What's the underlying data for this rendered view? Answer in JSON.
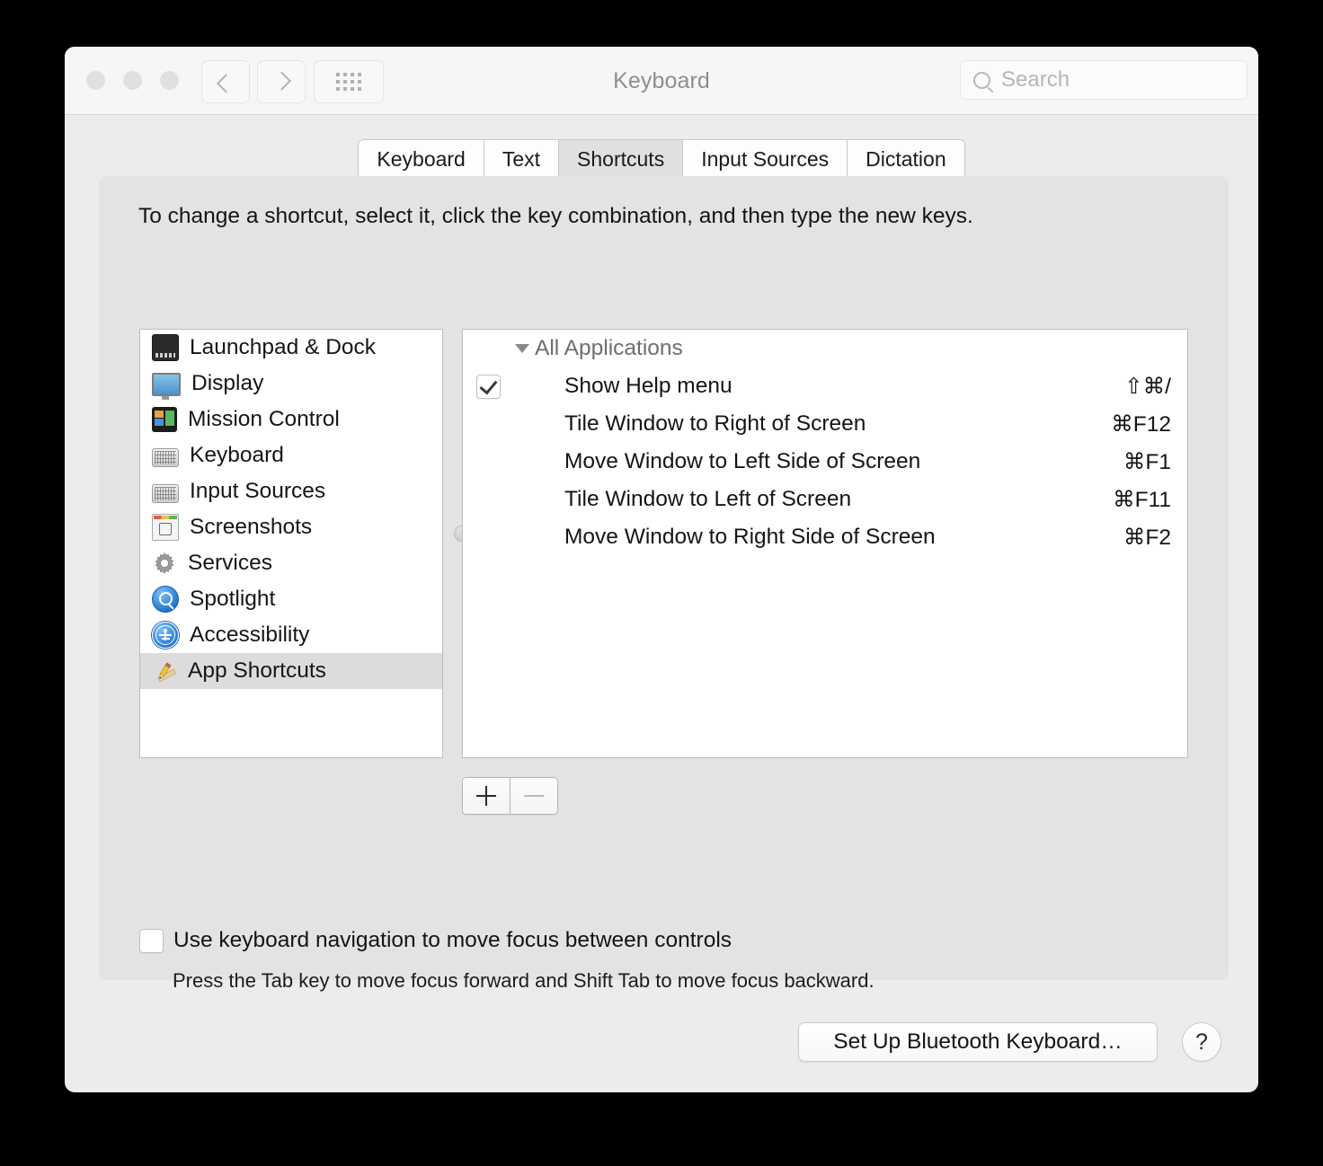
{
  "window": {
    "title": "Keyboard"
  },
  "toolbar": {
    "back_label": "",
    "forward_label": "",
    "grid_label": "",
    "search_placeholder": "Search"
  },
  "tabs": [
    {
      "label": "Keyboard",
      "selected": false
    },
    {
      "label": "Text",
      "selected": false
    },
    {
      "label": "Shortcuts",
      "selected": true
    },
    {
      "label": "Input Sources",
      "selected": false
    },
    {
      "label": "Dictation",
      "selected": false
    }
  ],
  "hint": "To change a shortcut, select it, click the key combination, and then type the new keys.",
  "sidebar": {
    "items": [
      {
        "label": "Launchpad & Dock",
        "icon": "launchpad-dock-icon",
        "selected": false
      },
      {
        "label": "Display",
        "icon": "display-icon",
        "selected": false
      },
      {
        "label": "Mission Control",
        "icon": "mission-control-icon",
        "selected": false
      },
      {
        "label": "Keyboard",
        "icon": "keyboard-icon",
        "selected": false
      },
      {
        "label": "Input Sources",
        "icon": "input-sources-icon",
        "selected": false
      },
      {
        "label": "Screenshots",
        "icon": "screenshots-icon",
        "selected": false
      },
      {
        "label": "Services",
        "icon": "gear-icon",
        "selected": false
      },
      {
        "label": "Spotlight",
        "icon": "spotlight-icon",
        "selected": false
      },
      {
        "label": "Accessibility",
        "icon": "accessibility-icon",
        "selected": false
      },
      {
        "label": "App Shortcuts",
        "icon": "app-shortcuts-icon",
        "selected": true
      }
    ]
  },
  "shortcut_list": {
    "group_label": "All Applications",
    "rows": [
      {
        "name": "Show Help menu",
        "key": "⇧⌘/",
        "checkbox": true,
        "checked": true
      },
      {
        "name": "Tile Window to Right of Screen",
        "key": "⌘F12",
        "checkbox": false,
        "checked": false
      },
      {
        "name": "Move Window to Left Side of Screen",
        "key": "⌘F1",
        "checkbox": false,
        "checked": false
      },
      {
        "name": "Tile Window to Left of Screen",
        "key": "⌘F11",
        "checkbox": false,
        "checked": false
      },
      {
        "name": "Move Window to Right Side of Screen",
        "key": "⌘F2",
        "checkbox": false,
        "checked": false
      }
    ]
  },
  "add_remove": {
    "add_label": "+",
    "remove_label": "−"
  },
  "keyboard_navigation": {
    "label": "Use keyboard navigation to move focus between controls",
    "checked": false,
    "description": "Press the Tab key to move focus forward and Shift Tab to move focus backward."
  },
  "footer": {
    "bluetooth_label": "Set Up Bluetooth Keyboard…",
    "help_label": "?"
  },
  "colors": {
    "window_bg": "#ececec",
    "titlebar_bg": "#f6f6f6",
    "panel_bg": "#e3e3e3",
    "selection_bg": "#dcdcdc",
    "list_bg": "#ffffff",
    "border": "#bdbdbd",
    "text": "#141414",
    "muted_text": "#8e8e8e"
  }
}
